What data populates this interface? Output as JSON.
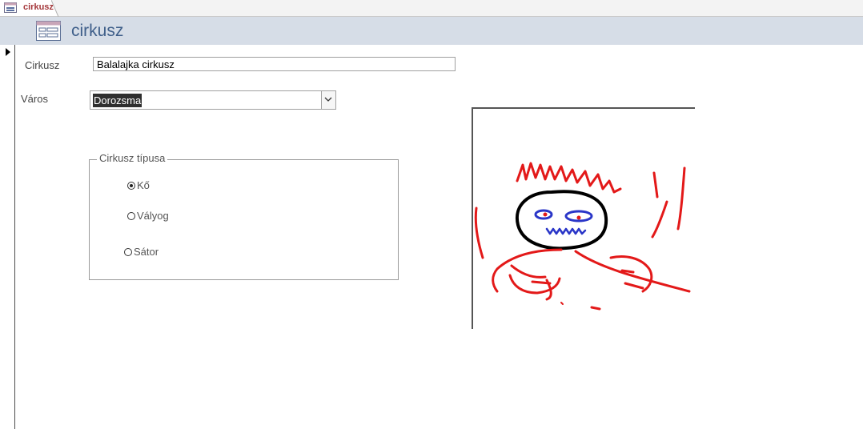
{
  "tab": {
    "label": "cirkusz",
    "accent_color": "#a4373a"
  },
  "header": {
    "title": "cirkusz",
    "icon": "form-icon"
  },
  "fields": {
    "cirkusz": {
      "label": "Cirkusz",
      "value": "Balalajka cirkusz"
    },
    "varos": {
      "label": "Város",
      "value": "Dorozsma",
      "dropdown_icon": "chevron-down-icon"
    }
  },
  "group": {
    "legend": "Cirkusz típusa",
    "options": [
      {
        "label": "Kő",
        "checked": true
      },
      {
        "label": "Vályog",
        "checked": false
      },
      {
        "label": "Sátor",
        "checked": false
      }
    ]
  },
  "picture": {
    "description_icon": "drawing-image"
  },
  "colors": {
    "header_bg": "#d6dde7",
    "title": "#3f5f8a",
    "drawing_red": "#e31919",
    "drawing_blue": "#2a36c8"
  }
}
